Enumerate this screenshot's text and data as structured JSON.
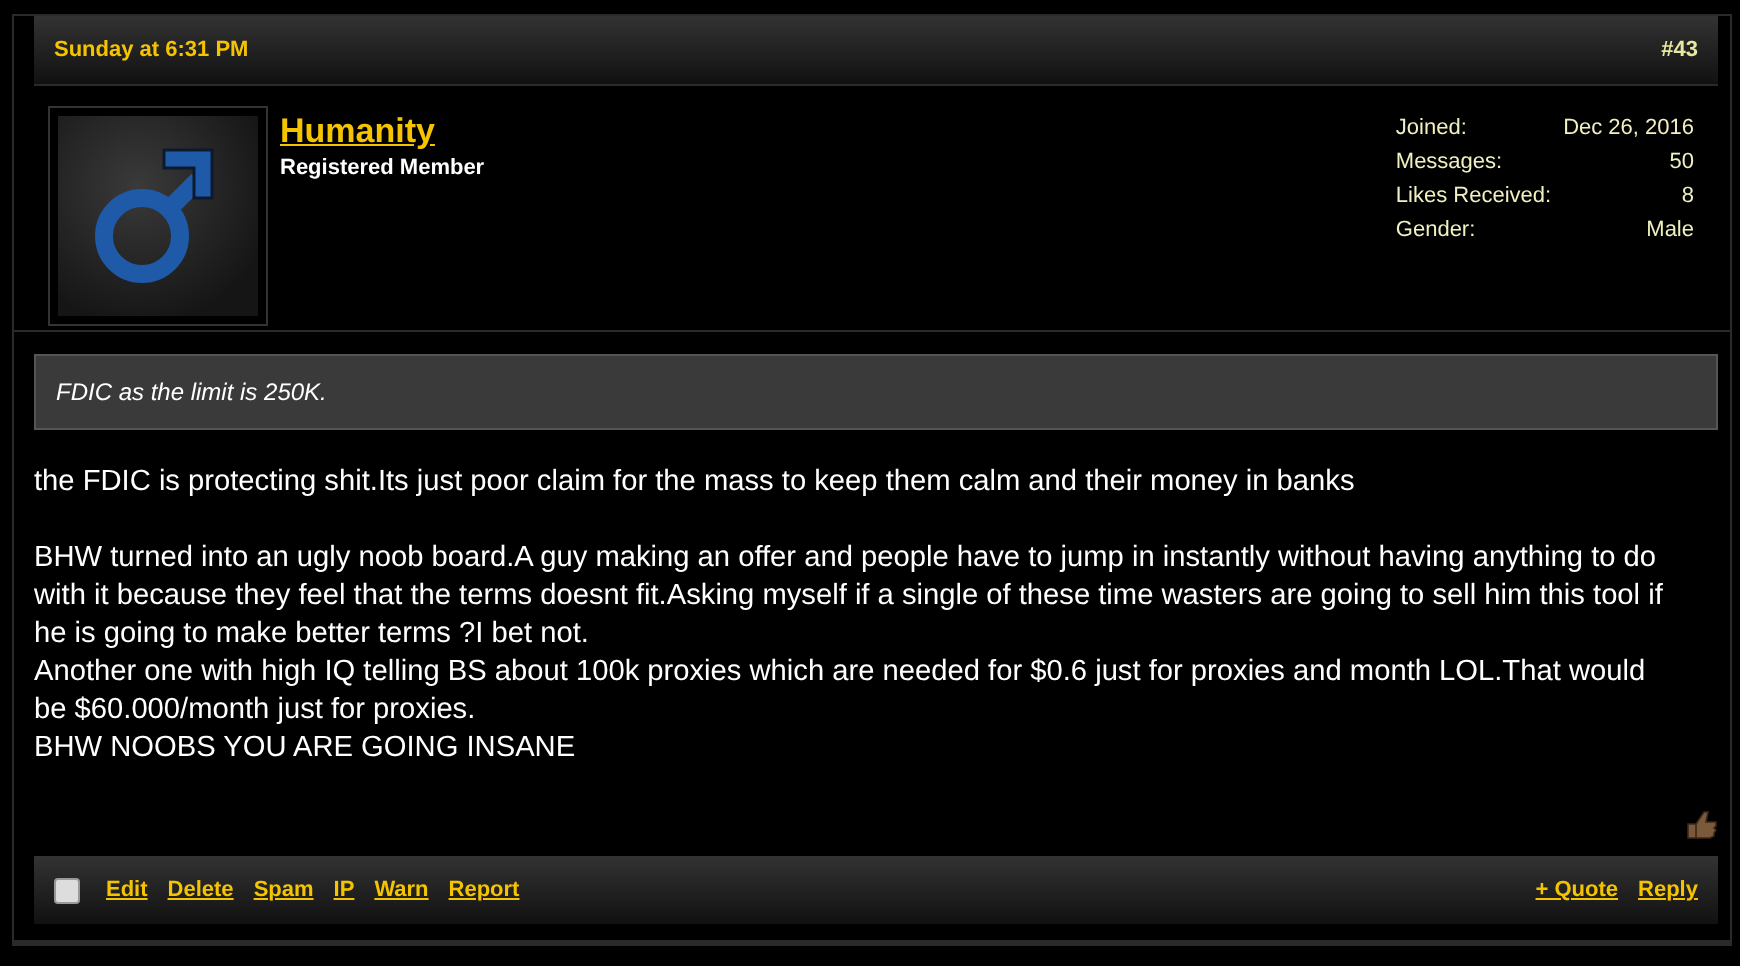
{
  "post": {
    "date": "Sunday at 6:31 PM",
    "number": "#43"
  },
  "author": {
    "name": "Humanity",
    "title": "Registered Member",
    "stats": [
      {
        "label": "Joined:",
        "value": "Dec 26, 2016"
      },
      {
        "label": "Messages:",
        "value": "50"
      },
      {
        "label": "Likes Received:",
        "value": "8"
      },
      {
        "label": "Gender:",
        "value": "Male"
      }
    ]
  },
  "quote": "FDIC as the limit is 250K.",
  "paragraphs": [
    "the FDIC is protecting shit.Its just poor claim for the mass to keep them calm and their money in banks",
    "BHW turned into an ugly noob board.A guy making an offer and people have to jump in instantly without having anything to do with it because they feel that the terms doesnt fit.Asking myself if a single of these time wasters are going to sell him this tool if he is going to make better terms ?I bet not.",
    "Another one with high IQ telling BS about 100k proxies which are needed for $0.6 just for proxies and month LOL.That would be $60.000/month just for proxies.",
    "BHW NOOBS YOU ARE GOING INSANE"
  ],
  "footer": {
    "select": {
      "checked": false
    },
    "left_links": [
      "Edit",
      "Delete",
      "Spam",
      "IP",
      "Warn",
      "Report"
    ],
    "right_links": [
      "+ Quote",
      "Reply"
    ]
  }
}
